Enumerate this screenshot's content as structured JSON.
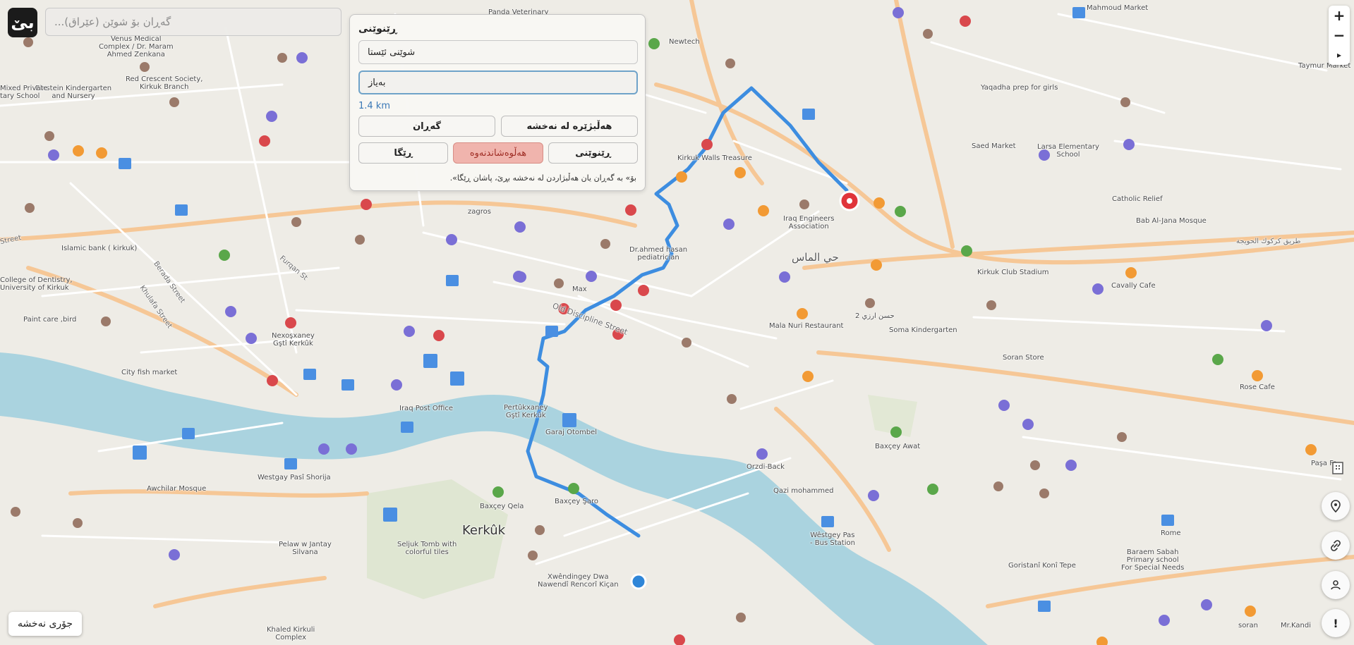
{
  "app": {
    "logo_text": "بێ"
  },
  "search": {
    "placeholder": "گەڕان بۆ شوێن (عێراق)..."
  },
  "route_panel": {
    "title": "ڕێنوێنی",
    "origin_value": "شوێنی ئێستا",
    "destination_value": "بەیاز",
    "distance": "1.4 km",
    "buttons": {
      "search": "گەڕان",
      "pick_on_map": "هەڵبژێرە لە نەخشە",
      "route": "ڕێگا",
      "clear": "هەڵوەشاندنەوە",
      "directions": "ڕێنوێنی"
    },
    "hint": "بۆ» بە گەڕان یان هەڵبژاردن لە نەخشە بڕێ، پاشان ڕێگا»."
  },
  "controls": {
    "zoom_in": "+",
    "zoom_out": "−",
    "collapse": "▸",
    "map_type": "جۆری نەخشە",
    "report": "!"
  },
  "colors": {
    "route": "#3d8de0",
    "river": "#aad3df",
    "major_road": "#f6c796",
    "current_location": "#2f86d8",
    "destination_marker": "#e0343a"
  },
  "map_labels": {
    "city": "Kerkûk",
    "district": "حي الماس",
    "places": [
      {
        "id": "city_fish",
        "text": "City fish market"
      },
      {
        "id": "islamic_bank",
        "text": "Islamic bank ( kirkuk)"
      },
      {
        "id": "dentistry",
        "text": "College of Dentistry,\nUniversity of Kirkuk"
      },
      {
        "id": "paint",
        "text": "Paint care ,bird"
      },
      {
        "id": "red_crescent",
        "text": "Red Crescent Society,\nKirkuk Branch"
      },
      {
        "id": "einstein",
        "text": "Einstein Kindergarten\nand Nursery"
      },
      {
        "id": "private_school",
        "text": "Mixed Private\ntary School"
      },
      {
        "id": "venus",
        "text": "Venus Medical\nComplex / Dr. Maram\nAhmed Zenkana"
      },
      {
        "id": "panda",
        "text": "Panda Veterinary"
      },
      {
        "id": "newtech",
        "text": "Newtech"
      },
      {
        "id": "mahmoud",
        "text": "Mahmoud Market"
      },
      {
        "id": "taymur",
        "text": "Taymur Market"
      },
      {
        "id": "yaqadha",
        "text": "Yaqadha prep for girls"
      },
      {
        "id": "saed",
        "text": "Saed Market"
      },
      {
        "id": "larsa",
        "text": "Larsa Elementary\nSchool"
      },
      {
        "id": "catholic",
        "text": "Catholic Relief"
      },
      {
        "id": "bab_ajana",
        "text": "Bab Al-Jana Mosque"
      },
      {
        "id": "kirkuk_walls",
        "text": "Kirkuk Walls Treasure"
      },
      {
        "id": "iraq_engineers",
        "text": "Iraq Engineers\nAssociation"
      },
      {
        "id": "kirkuk_club",
        "text": "Kirkuk Club Stadium"
      },
      {
        "id": "cavally",
        "text": "Cavally Cafe"
      },
      {
        "id": "dr_ahmed",
        "text": "Dr.ahmed hasan\npediatrician"
      },
      {
        "id": "max",
        "text": "Max"
      },
      {
        "id": "mala_nuri",
        "text": "Mala Nuri Restaurant"
      },
      {
        "id": "soma",
        "text": "Soma Kindergarten"
      },
      {
        "id": "soran_store",
        "text": "Soran Store"
      },
      {
        "id": "rose",
        "text": "Rose Cafe"
      },
      {
        "id": "old_discipline",
        "text": "Old Discipline Street"
      },
      {
        "id": "nexosxaney",
        "text": "Nexoşxaney\nGştî Kerkûk"
      },
      {
        "id": "iraq_post",
        "text": "Iraq Post Office"
      },
      {
        "id": "zagros",
        "text": "zagros"
      },
      {
        "id": "pertukxaney",
        "text": "Pertûkxaney\nGştî Kerkûk"
      },
      {
        "id": "garaj",
        "text": "Garaj Otombel"
      },
      {
        "id": "westgay",
        "text": "Westgay Pasî Shorija"
      },
      {
        "id": "awchilar",
        "text": "Awchilar Mosque"
      },
      {
        "id": "pelaw",
        "text": "Pelaw w Jantay\nSilvana"
      },
      {
        "id": "seljuk",
        "text": "Seljuk Tomb with\ncolorful tiles"
      },
      {
        "id": "baxcey_qela",
        "text": "Baxçey Qela"
      },
      {
        "id": "baxcey_saro",
        "text": "Baxçey Şaro"
      },
      {
        "id": "xwendingey",
        "text": "Xwêndingey Dwa\nNawendî Rencorî Kiçan"
      },
      {
        "id": "khaled",
        "text": "Khaled Kirkuli\nComplex"
      },
      {
        "id": "orzdi",
        "text": "Orzdi-Back"
      },
      {
        "id": "qazi",
        "text": "Qazi mohammed"
      },
      {
        "id": "baxcey_awat",
        "text": "Baxçey Awat"
      },
      {
        "id": "westgey_bus",
        "text": "Wêstgey Pas\n- Bus Station"
      },
      {
        "id": "goristani",
        "text": "Goristanî Konî Tepe"
      },
      {
        "id": "baraem",
        "text": "Baraem Sabah\nPrimary school\nFor Special Needs"
      },
      {
        "id": "rome",
        "text": "Rome"
      },
      {
        "id": "pasa",
        "text": "Paşa Fa"
      },
      {
        "id": "soran2",
        "text": "soran"
      },
      {
        "id": "mr_kandi",
        "text": "Mr.Kandi"
      },
      {
        "id": "old_city_label",
        "text": "Furqan St"
      },
      {
        "id": "berada",
        "text": "Berada Street"
      },
      {
        "id": "khulafa",
        "text": "Khulafa Street"
      },
      {
        "id": "street_w",
        "text": "Street"
      },
      {
        "id": "kirkuk_karak",
        "text": "طريق كركوك الحويجة"
      },
      {
        "id": "haji",
        "text": "حسن ارزي 2"
      }
    ]
  }
}
